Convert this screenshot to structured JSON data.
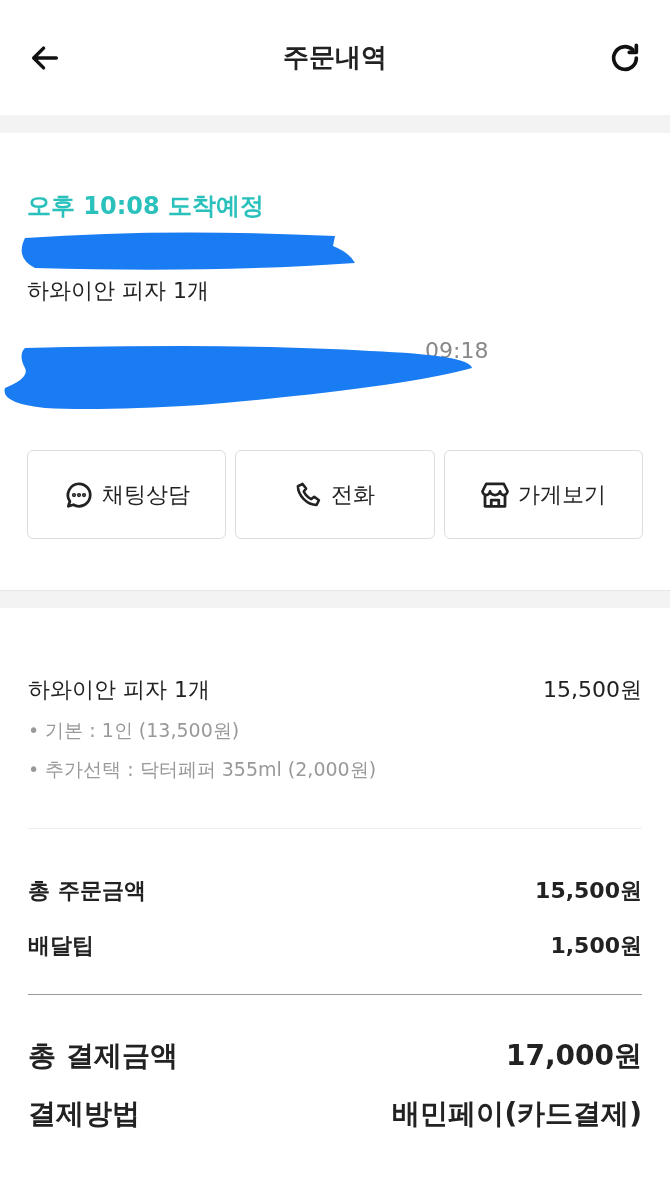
{
  "header": {
    "title": "주문내역"
  },
  "order": {
    "eta": "오후 10:08 도착예정",
    "summary": "하와이안 피자 1개",
    "time": "09:18"
  },
  "actions": [
    {
      "kind": "chat",
      "label": "채팅상담"
    },
    {
      "kind": "phone",
      "label": "전화"
    },
    {
      "kind": "store",
      "label": "가게보기"
    }
  ],
  "items": [
    {
      "name": "하와이안 피자 1개",
      "price": "15,500원",
      "options": [
        "• 기본 : 1인 (13,500원)",
        "• 추가선택 : 닥터페퍼 355ml (2,000원)"
      ]
    }
  ],
  "subtotals": [
    {
      "label": "총 주문금액",
      "value": "15,500원"
    },
    {
      "label": "배달팁",
      "value": "1,500원"
    }
  ],
  "totals": [
    {
      "label": "총 결제금액",
      "value": "17,000원"
    },
    {
      "label": "결제방법",
      "value": "배민페이(카드결제)"
    }
  ]
}
